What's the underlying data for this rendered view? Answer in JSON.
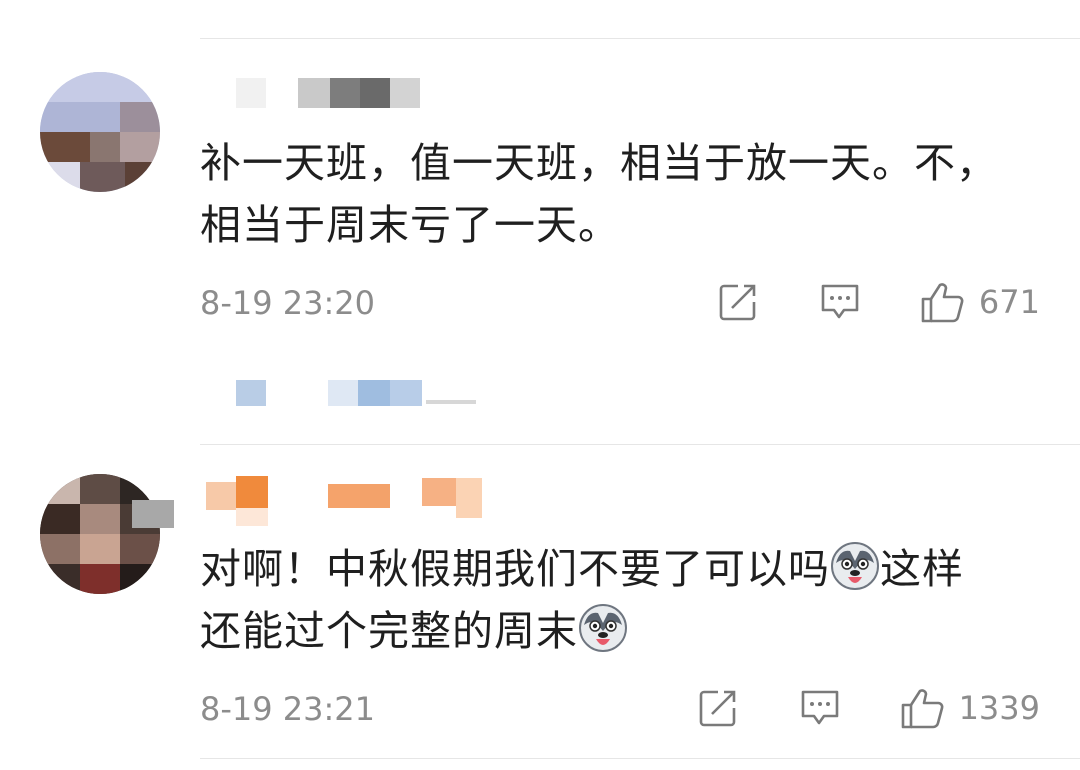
{
  "comments": [
    {
      "text_line1": "补一天班，值一天班，相当于放一天。不，",
      "text_line2": "相当于周末亏了一天。",
      "timestamp": "8-19 23:20",
      "likes": "671",
      "icons": [
        "share-icon",
        "reply-icon",
        "thumbs-up-icon"
      ]
    },
    {
      "text_line1a": "对啊！中秋假期我们不要了可以吗",
      "text_line1b": "这样",
      "text_line2": "还能过个完整的周末",
      "timestamp": "8-19 23:21",
      "likes": "1339",
      "emoji": "husky-emoji",
      "icons": [
        "share-icon",
        "reply-icon",
        "thumbs-up-icon"
      ]
    }
  ],
  "colors": {
    "text": "#1f1f1f",
    "meta": "#8c8c8c",
    "divider": "#e6e6e6",
    "icon": "#7a7a7a"
  }
}
